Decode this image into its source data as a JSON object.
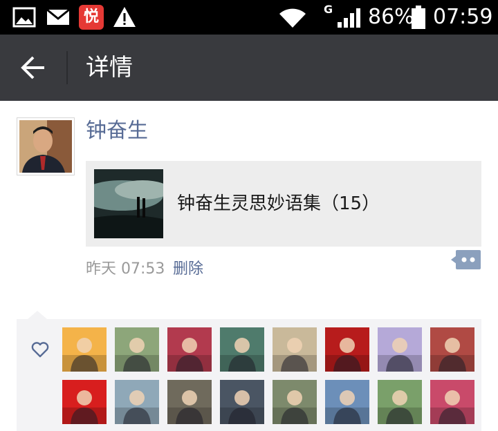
{
  "status_bar": {
    "network_type": "G",
    "battery": "86%",
    "time": "07:59",
    "notification_badge": "悦"
  },
  "app_bar": {
    "title": "详情"
  },
  "post": {
    "author": "钟奋生",
    "share_title": "钟奋生灵思妙语集（15）",
    "time": "昨天 07:53",
    "delete_label": "删除"
  },
  "likes": {
    "avatars": [
      {
        "color": "#f4b349"
      },
      {
        "color": "#8da67a"
      },
      {
        "color": "#b23a4e"
      },
      {
        "color": "#4f7b6c"
      },
      {
        "color": "#c9b99a"
      },
      {
        "color": "#b71c1c"
      },
      {
        "color": "#b5a9d8"
      },
      {
        "color": "#b04a44"
      },
      {
        "color": "#d81e1e"
      },
      {
        "color": "#8fa8b8"
      },
      {
        "color": "#6f6a5c"
      },
      {
        "color": "#4a5563"
      },
      {
        "color": "#7d8a6c"
      },
      {
        "color": "#6c8fb9"
      },
      {
        "color": "#7aa06a"
      },
      {
        "color": "#c94a6a"
      }
    ]
  },
  "colors": {
    "link_blue": "#576b95",
    "app_bar": "#393a3e",
    "likes_bg": "#f3f3f5"
  }
}
